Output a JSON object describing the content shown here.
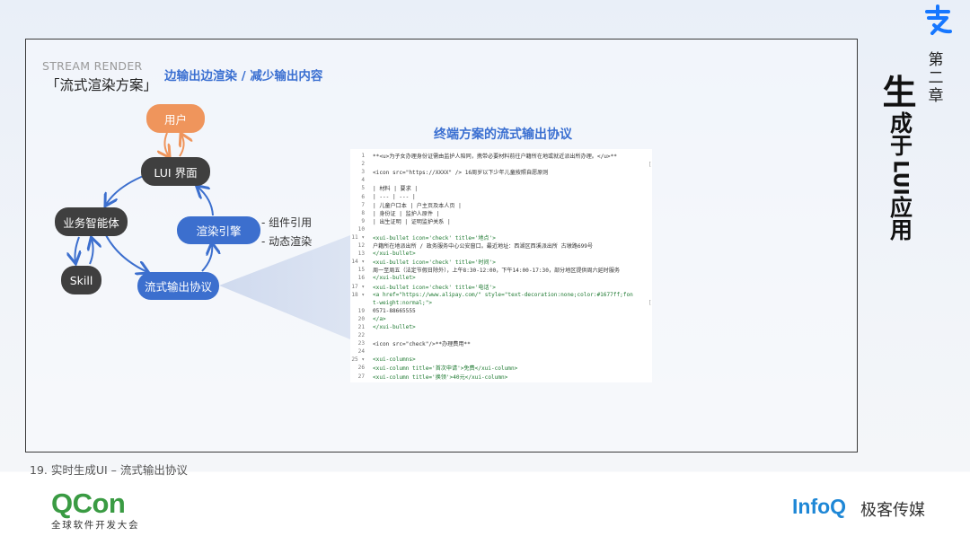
{
  "header": {
    "stream_label": "STREAM RENDER",
    "scheme_title": "「流式渲染方案」",
    "subtitle": "边输出边渲染 / 减少输出内容"
  },
  "diagram": {
    "nodes": {
      "user": "用户",
      "lui": "LUI 界面",
      "business": "业务智能体",
      "render": "渲染引擎",
      "skill": "Skill",
      "protocol": "流式输出协议"
    },
    "render_notes": [
      "-  组件引用",
      "-  动态渲染"
    ]
  },
  "protocol_panel": {
    "title": "终端方案的流式输出协议",
    "lines": [
      {
        "n": "1",
        "text": "**<u>为子女办理身份证需由监护人陪同，携带必要材料前往户籍所在地或就近派出所办理。</u>**",
        "kind": "plain"
      },
      {
        "n": "2",
        "text": "",
        "kind": "plain"
      },
      {
        "n": "3",
        "text": "<icon  src=\"https://XXXX\" />  16周岁以下少年儿童按照自愿原则",
        "kind": "plain"
      },
      {
        "n": "4",
        "text": "",
        "kind": "plain"
      },
      {
        "n": "5",
        "text": "| 材料  | 要求 |",
        "kind": "plain"
      },
      {
        "n": "6",
        "text": "| --- | --- |",
        "kind": "plain"
      },
      {
        "n": "7",
        "text": "| 儿童户口本  | 户主页及本人页 |",
        "kind": "plain"
      },
      {
        "n": "8",
        "text": "| 身份证  | 监护人原件 |",
        "kind": "plain"
      },
      {
        "n": "9",
        "text": "| 出生证明  | 证明监护关系 |",
        "kind": "plain"
      },
      {
        "n": "10",
        "text": "",
        "kind": "plain"
      },
      {
        "n": "11 ▾",
        "text": "<xui-bullet icon='check' title='地点'>",
        "kind": "tag"
      },
      {
        "n": "12",
        "text": "  户籍所在地派出所 / 政务服务中心公安窗口。最近地址：西湖区西溪派出所 古墩路699号",
        "kind": "plain"
      },
      {
        "n": "13",
        "text": "</xui-bullet>",
        "kind": "tag"
      },
      {
        "n": "14 ▾",
        "text": "<xui-bullet icon='check' title='时间'>",
        "kind": "tag"
      },
      {
        "n": "15",
        "text": "  周一至周五（法定节假日除外），上午8:30-12:00，下午14:00-17:30，部分地区提供周六延时服务",
        "kind": "plain"
      },
      {
        "n": "16",
        "text": "</xui-bullet>",
        "kind": "tag"
      },
      {
        "n": "17 ▾",
        "text": "<xui-bullet icon='check' title='电话'>",
        "kind": "tag"
      },
      {
        "n": "18 ▾",
        "text": "  <a href=\"https://www.alipay.com/\" style=\"text-decoration:none;color:#1677ff;fon",
        "kind": "tag"
      },
      {
        "n": "",
        "text": "t-weight:normal;\">",
        "kind": "tag"
      },
      {
        "n": "19",
        "text": "    0571-88665555",
        "kind": "plain"
      },
      {
        "n": "20",
        "text": "  </a>",
        "kind": "tag"
      },
      {
        "n": "21",
        "text": "</xui-bullet>",
        "kind": "tag"
      },
      {
        "n": "22",
        "text": "",
        "kind": "plain"
      },
      {
        "n": "23",
        "text": "<icon  src=\"check\"/>**办理费用**",
        "kind": "plain"
      },
      {
        "n": "24",
        "text": "",
        "kind": "plain"
      },
      {
        "n": "25 ▾",
        "text": "<xui-columns>",
        "kind": "tag"
      },
      {
        "n": "26",
        "text": "  <xui-column title='首次申请'>免费</xui-column>",
        "kind": "tag"
      },
      {
        "n": "27",
        "text": "  <xui-column title='换领'>40元</xui-column>",
        "kind": "tag"
      }
    ]
  },
  "sidebar": {
    "chapter": "第二章",
    "title_big": "生",
    "title_line1": "成于",
    "title_latin": "LUI",
    "title_line2": "应用"
  },
  "footer": {
    "caption": "19. 实时生成UI – 流式输出协议",
    "qcon_logo": "QCon",
    "qcon_sub": "全球软件开发大会",
    "infoq_logo": "InfoQ",
    "infoq_cn": "极客传媒"
  },
  "colors": {
    "accent": "#3a6fd1",
    "node_user": "#ef955c",
    "node_dark": "#3f3f3f",
    "node_blue": "#3c6fce",
    "qcon_green": "#3a9b43",
    "infoq_blue": "#1e87d6"
  }
}
